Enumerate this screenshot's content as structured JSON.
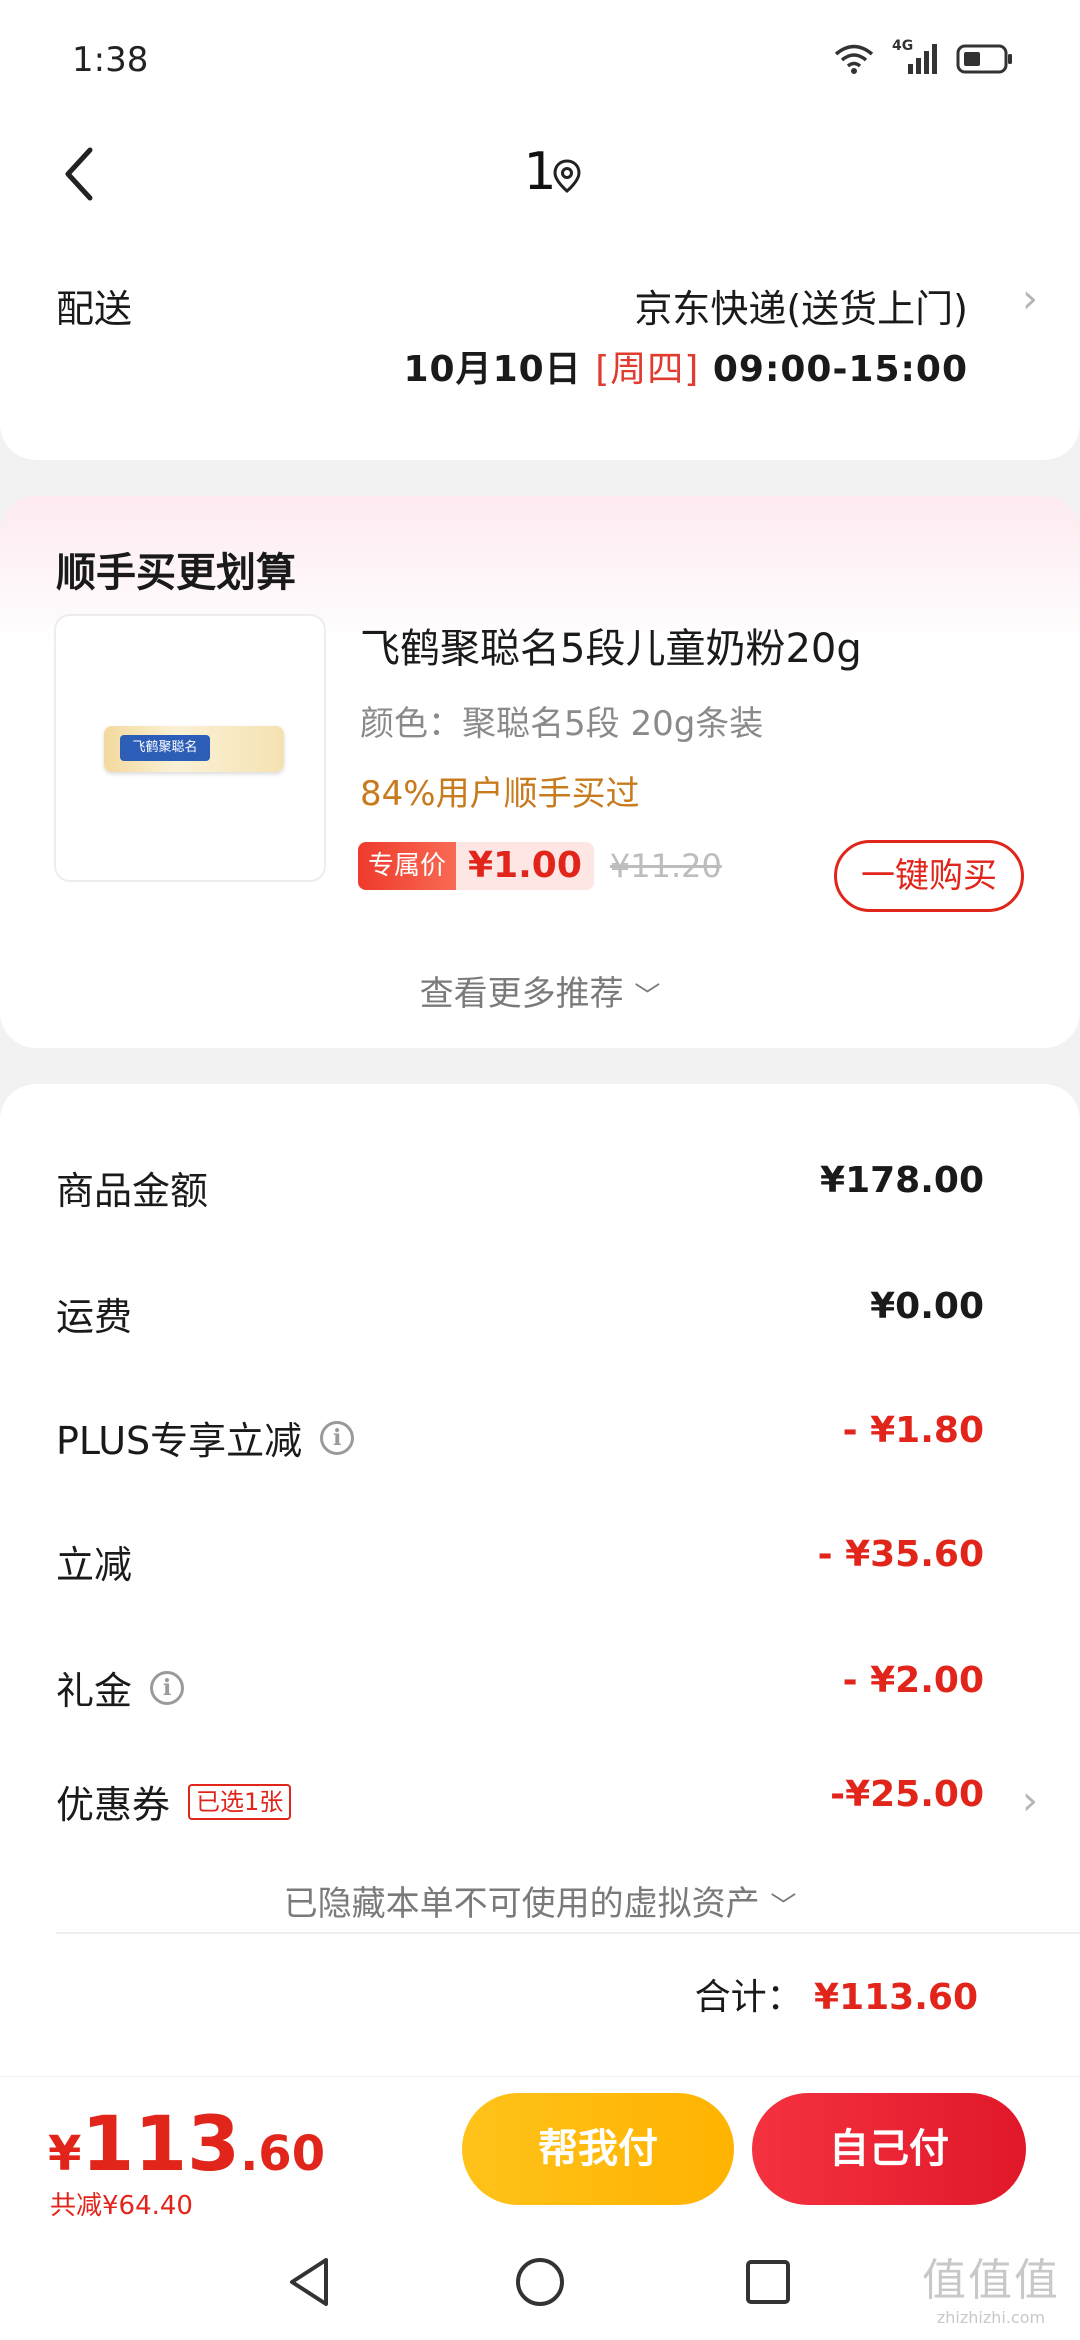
{
  "status_bar": {
    "time": "1:38",
    "network": "4G"
  },
  "header": {
    "title": "1"
  },
  "delivery": {
    "label": "配送",
    "method": "京东快递(送货上门)",
    "date": "10月10日",
    "weekday": "[周四]",
    "time_window": "09:00-15:00"
  },
  "upsell": {
    "title": "顺手买更划算",
    "product": {
      "image_label": "飞鹤聚聪名",
      "name": "飞鹤聚聪名5段儿童奶粉20g",
      "spec": "颜色：聚聪名5段 20g条装",
      "social_proof": "84%用户顺手买过",
      "price_tag": "专属价",
      "price": "¥1.00",
      "original_price": "¥11.20",
      "buy_button": "一键购买"
    },
    "more": "查看更多推荐"
  },
  "summary": {
    "rows": [
      {
        "label": "商品金额",
        "value": "¥178.00"
      },
      {
        "label": "运费",
        "value": "¥0.00"
      },
      {
        "label": "PLUS专享立减",
        "value": "- ¥1.80"
      },
      {
        "label": "立减",
        "value": "- ¥35.60"
      },
      {
        "label": "礼金",
        "value": "- ¥2.00"
      },
      {
        "label": "优惠券",
        "badge": "已选1张",
        "value": "-¥25.00"
      }
    ],
    "hidden_note": "已隐藏本单不可使用的虚拟资产",
    "total_label": "合计：",
    "total_value": "¥113.60"
  },
  "bottom_bar": {
    "currency": "¥",
    "total_int": "113",
    "total_dec": ".60",
    "saved": "共减¥64.40",
    "help_pay": "帮我付",
    "self_pay": "自己付"
  },
  "watermark": {
    "logo_text": "值值值",
    "site": "zhizhizhi.com"
  },
  "colors": {
    "accent_red": "#e1251b",
    "help_pay_yellow": "#ffc21a",
    "social_orange": "#c77b1d"
  }
}
